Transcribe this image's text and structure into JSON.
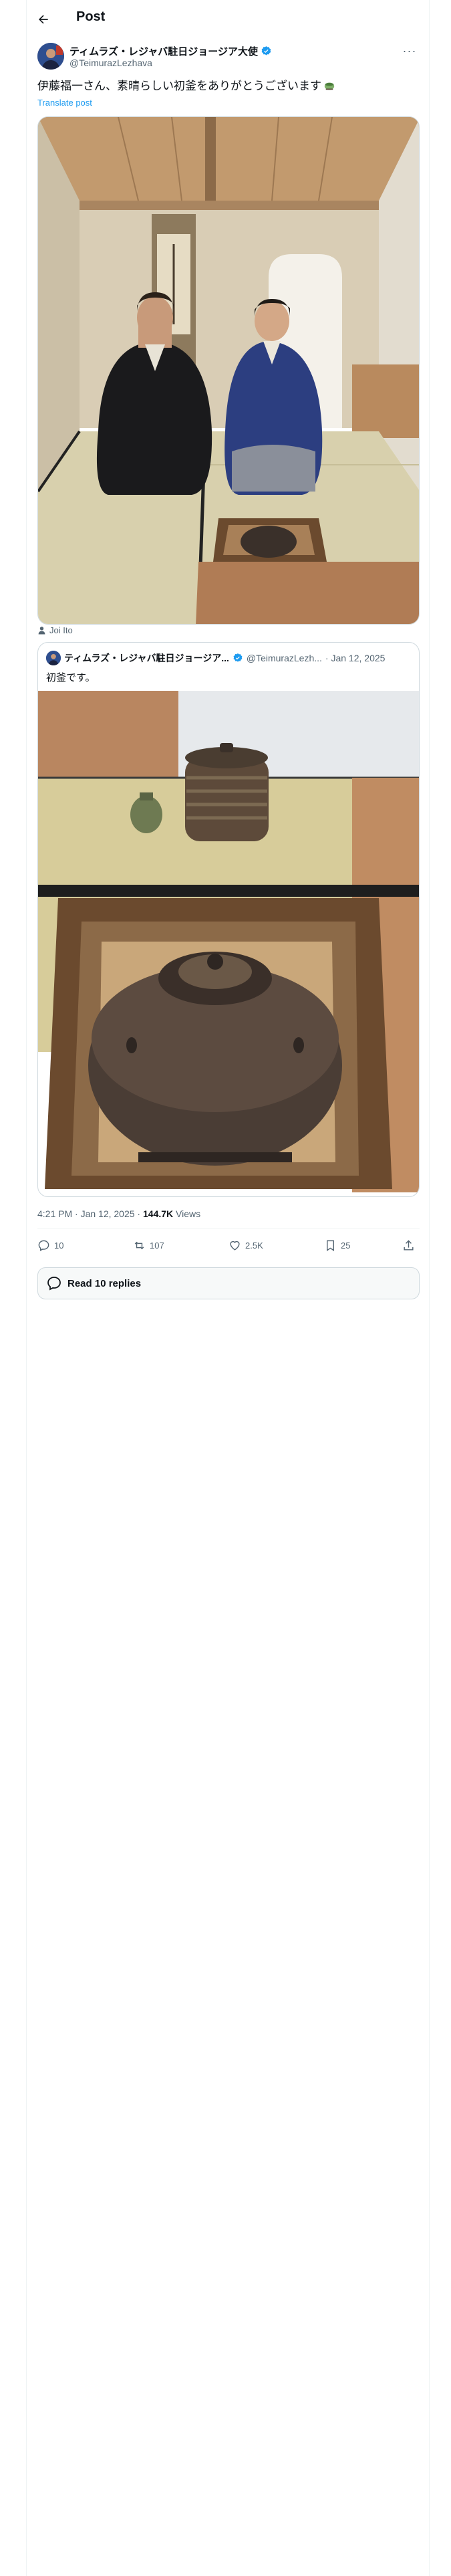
{
  "header": {
    "title": "Post"
  },
  "post": {
    "author_name": "ティムラズ・レジャバ駐日ジョージア大使",
    "author_handle": "@TeimurazLezhava",
    "text": "伊藤福一さん、素晴らしい初釜をありがとうございます",
    "translate_label": "Translate post",
    "tagged_user": "Joi Ito",
    "timestamp": "4:21 PM · Jan 12, 2025",
    "views_count": "144.7K",
    "views_label": "Views"
  },
  "quote": {
    "author_name": "ティムラズ・レジャバ駐日ジョージア...",
    "author_handle": "@TeimurazLezh...",
    "date": "· Jan 12, 2025",
    "text": "初釜です。"
  },
  "actions": {
    "replies": "10",
    "reposts": "107",
    "likes": "2.5K",
    "bookmarks": "25"
  },
  "read_replies_label": "Read 10 replies",
  "icons": {
    "back": "arrow-left-icon",
    "more": "more-icon",
    "verified": "verified-badge-icon",
    "reply": "reply-icon",
    "repost": "repost-icon",
    "like": "heart-icon",
    "bookmark": "bookmark-icon",
    "share": "share-icon",
    "person": "person-icon",
    "replies": "speech-bubble-icon"
  },
  "colors": {
    "accent": "#1d9bf0",
    "text": "#0f1419",
    "muted": "#536471",
    "border": "#cfd9de"
  }
}
